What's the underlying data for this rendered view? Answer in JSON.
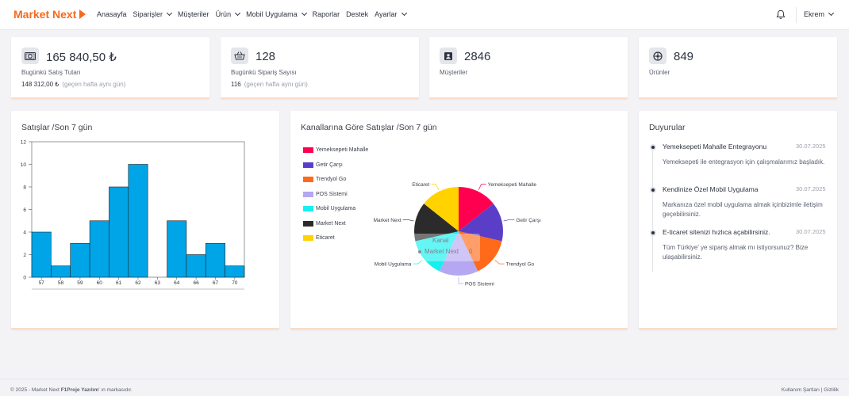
{
  "brand": {
    "name": "Market Next",
    "color": "#f36a1f"
  },
  "nav": [
    {
      "label": "Anasayfa",
      "dropdown": false
    },
    {
      "label": "Siparişler",
      "dropdown": true
    },
    {
      "label": "Müşteriler",
      "dropdown": false
    },
    {
      "label": "Ürün",
      "dropdown": true
    },
    {
      "label": "Mobil Uygulama",
      "dropdown": true
    },
    {
      "label": "Raporlar",
      "dropdown": false
    },
    {
      "label": "Destek",
      "dropdown": false
    },
    {
      "label": "Ayarlar",
      "dropdown": true
    }
  ],
  "user": {
    "name": "Ekrem",
    "icon": "bell-icon"
  },
  "stats": [
    {
      "icon": "money-icon",
      "value": "165 840,50 ₺",
      "label": "Bugünkü Satış Tutarı",
      "sub_value": "148 312,00 ₺",
      "sub_note": "(geçen hafta aynı gün)"
    },
    {
      "icon": "basket-icon",
      "value": "128",
      "label": "Bugünkü Sipariş Sayısı",
      "sub_value": "116",
      "sub_note": "(geçen hafta aynı gün)"
    },
    {
      "icon": "contacts-icon",
      "value": "2846",
      "label": "Müşteriler"
    },
    {
      "icon": "products-icon",
      "value": "849",
      "label": "Ürünler"
    }
  ],
  "sales_chart": {
    "title": "Satışlar /Son 7 gün"
  },
  "channels_chart": {
    "title": "Kanallarına Göre Satışlar /Son 7 gün"
  },
  "chart_data": [
    {
      "type": "bar",
      "title": "Satışlar /Son 7 gün",
      "categories": [
        "57",
        "58",
        "59",
        "60",
        "61",
        "62",
        "63",
        "64",
        "66",
        "67",
        "70"
      ],
      "values": [
        4,
        1,
        3,
        5,
        8,
        10,
        0,
        5,
        2,
        3,
        1
      ],
      "ylim": [
        0,
        12
      ],
      "yticks": [
        0,
        2,
        4,
        6,
        8,
        10,
        12
      ],
      "color": "#00a5e8"
    },
    {
      "type": "pie",
      "title": "Kanallarına Göre Satışlar /Son 7 gün",
      "series": [
        {
          "name": "Yemeksepeti Mahalle",
          "value": 1,
          "color": "#ff0050"
        },
        {
          "name": "Getir Çarşı",
          "value": 1,
          "color": "#5a3ec8"
        },
        {
          "name": "Trendyol Go",
          "value": 1,
          "color": "#ff6a1a"
        },
        {
          "name": "POS Sistemi",
          "value": 1,
          "color": "#b5a7f2"
        },
        {
          "name": "Mobil Uygulama",
          "value": 1,
          "color": "#14f0f0"
        },
        {
          "name": "Market Next",
          "value": 1,
          "color": "#2b2b2b"
        },
        {
          "name": "Eticaret",
          "value": 1,
          "color": "#ffd200"
        }
      ],
      "legend": "left"
    }
  ],
  "tooltip": {
    "title": "Kanal",
    "item": "Market Next",
    "value": "0"
  },
  "announcements": {
    "title": "Duyurular",
    "items": [
      {
        "title": "Yemeksepeti Mahalle Entegrayonu",
        "date": "30.07.2025",
        "body": "Yemeksepeti ile entegrasyon için çalışmalarımız başladık."
      },
      {
        "title": "Kendinize Özel Mobil Uygulama",
        "date": "30.07.2025",
        "body": "Markanıza özel mobil uygulama almak içinbizimle iletişim geçebilirsiniz."
      },
      {
        "title": "E-ticaret sitenizi hızlıca açabilirsiniz.",
        "date": "30.07.2025",
        "body": "Tüm Türkiye' ye sipariş almak mı istiyorsunuz? Bize ulaşabilirsiniz."
      }
    ]
  },
  "footer": {
    "left_prefix": "© 2025 - Market Next ",
    "left_bold": "F1Proje Yazılım",
    "left_suffix": "' ın markasıdır.",
    "right": "Kullanım Şartları | Gizlilik"
  }
}
